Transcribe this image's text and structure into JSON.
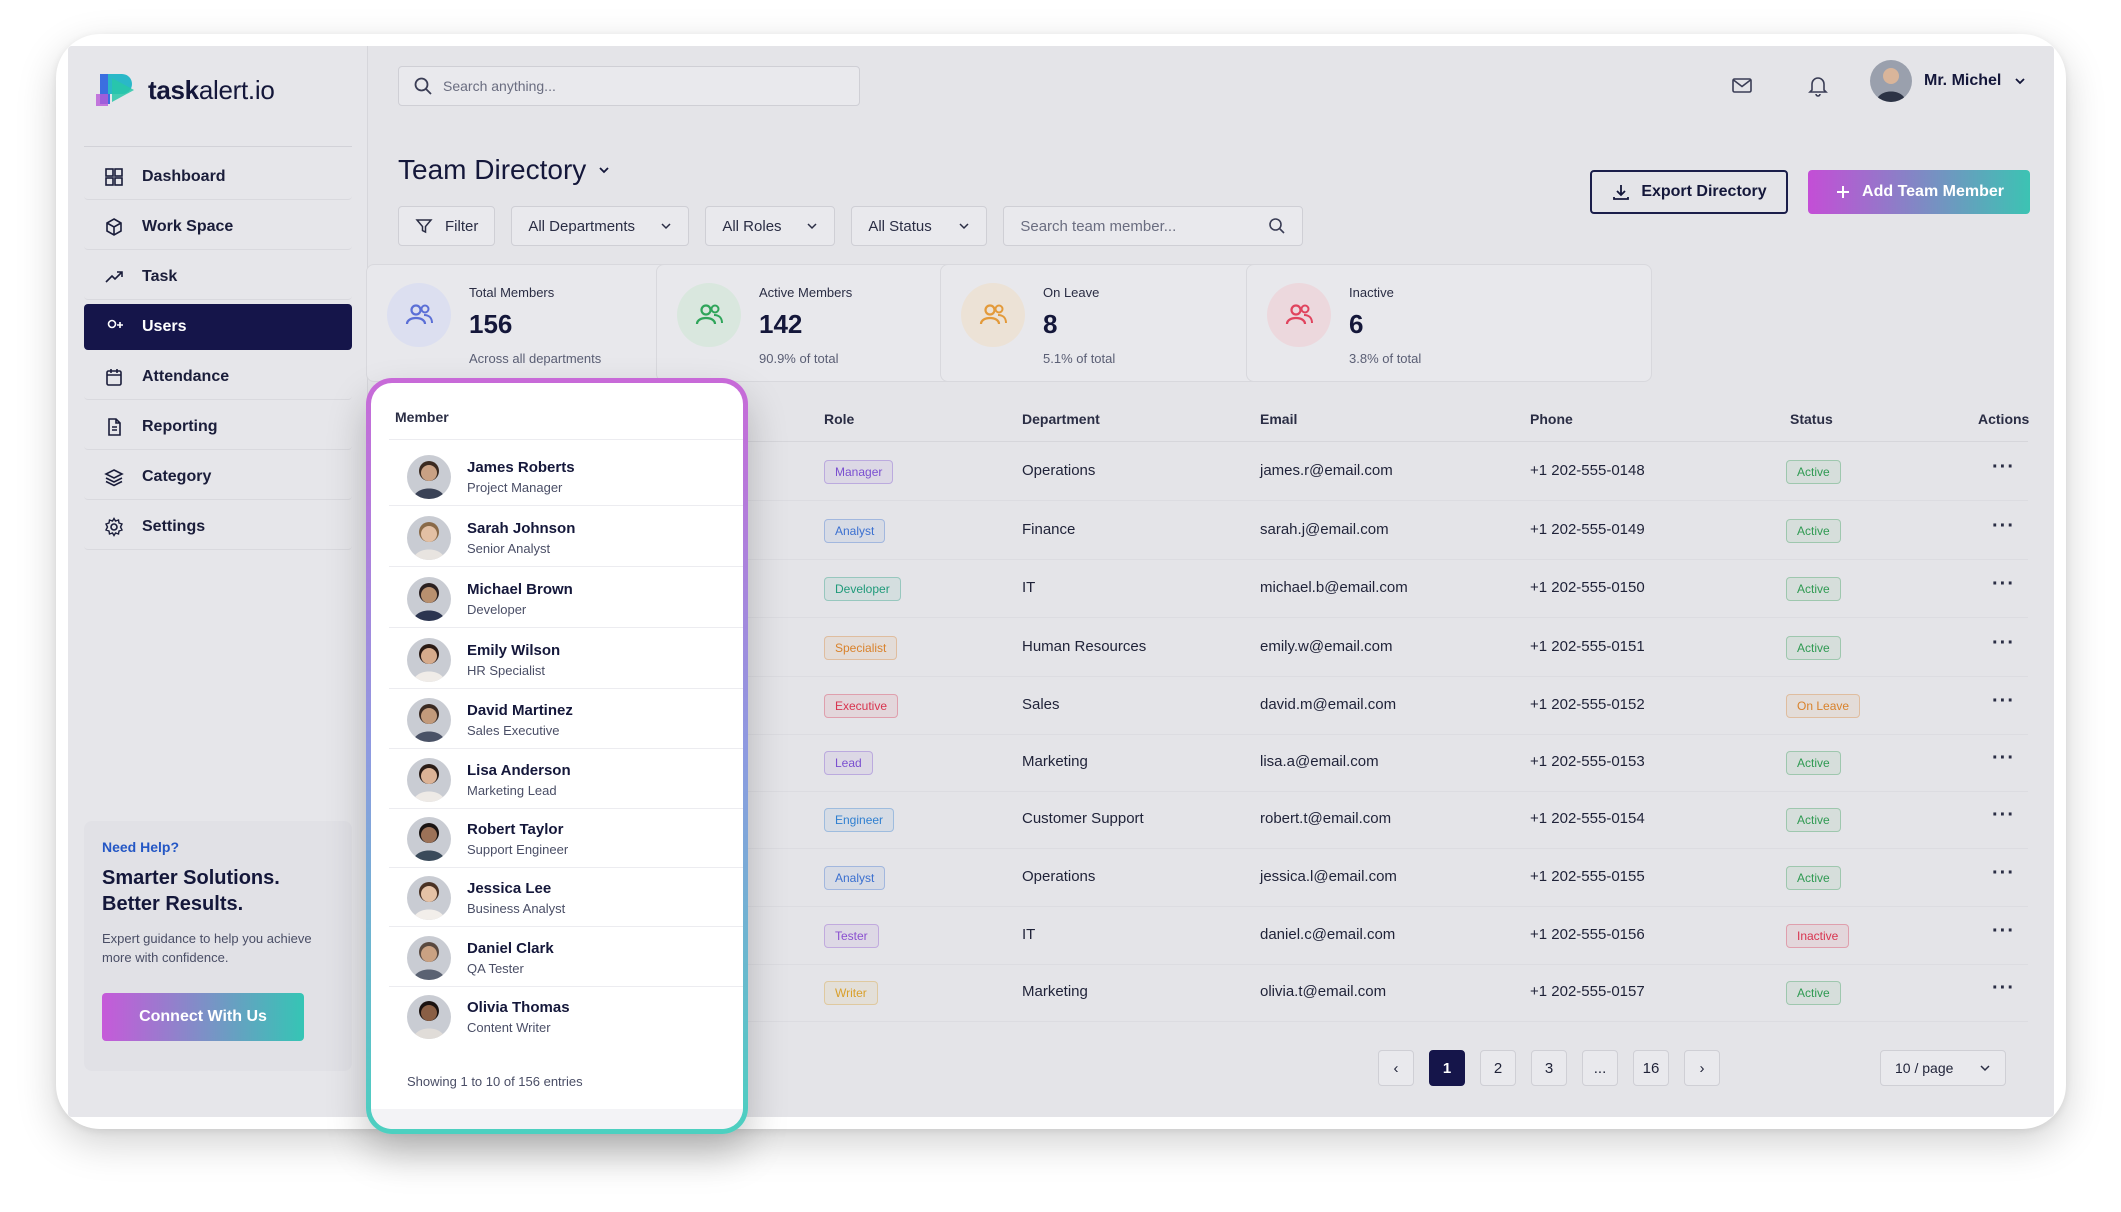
{
  "brand": {
    "name_bold": "task",
    "name_light": "alert.io"
  },
  "nav": [
    {
      "label": "Dashboard",
      "icon": "grid-icon"
    },
    {
      "label": "Work Space",
      "icon": "cube-icon"
    },
    {
      "label": "Task",
      "icon": "trend-icon"
    },
    {
      "label": "Users",
      "icon": "user-add-icon",
      "active": true
    },
    {
      "label": "Attendance",
      "icon": "calendar-icon"
    },
    {
      "label": "Reporting",
      "icon": "document-icon"
    },
    {
      "label": "Category",
      "icon": "layers-icon"
    },
    {
      "label": "Settings",
      "icon": "gear-icon"
    }
  ],
  "help": {
    "kicker": "Need Help?",
    "title_line1": "Smarter Solutions.",
    "title_line2": "Better Results.",
    "desc": "Expert guidance to help you achieve more with confidence.",
    "button": "Connect With Us"
  },
  "topbar": {
    "search_placeholder": "Search anything...",
    "user_name": "Mr. Michel"
  },
  "header": {
    "title": "Team Directory",
    "export_label": "Export Directory",
    "add_label": "Add Team Member"
  },
  "filters": {
    "filter_label": "Filter",
    "departments": "All Departments",
    "roles": "All Roles",
    "status": "All Status",
    "search_placeholder": "Search team member..."
  },
  "stats": [
    {
      "label": "Total Members",
      "value": "156",
      "sub": "Across all departments",
      "color": "#5b6fd6",
      "bg": "#dcdff0"
    },
    {
      "label": "Active Members",
      "value": "142",
      "sub": "90.9% of total",
      "color": "#2fa55a",
      "bg": "#d9e7de"
    },
    {
      "label": "On Leave",
      "value": "8",
      "sub": "5.1% of total",
      "color": "#e39a3a",
      "bg": "#ece2d6"
    },
    {
      "label": "Inactive",
      "value": "6",
      "sub": "3.8% of total",
      "color": "#e0445e",
      "bg": "#ecd8dd"
    }
  ],
  "table": {
    "headers": {
      "member": "Member",
      "role": "Role",
      "department": "Department",
      "email": "Email",
      "phone": "Phone",
      "status": "Status",
      "actions": "Actions"
    },
    "rows": [
      {
        "name": "James Roberts",
        "title": "Project Manager",
        "role": "Manager",
        "dept": "Operations",
        "email": "james.r@email.com",
        "phone": "+1 202-555-0148",
        "status": "Active"
      },
      {
        "name": "Sarah Johnson",
        "title": "Senior Analyst",
        "role": "Analyst",
        "dept": "Finance",
        "email": "sarah.j@email.com",
        "phone": "+1 202-555-0149",
        "status": "Active"
      },
      {
        "name": "Michael Brown",
        "title": "Developer",
        "role": "Developer",
        "dept": "IT",
        "email": "michael.b@email.com",
        "phone": "+1 202-555-0150",
        "status": "Active"
      },
      {
        "name": "Emily Wilson",
        "title": "HR Specialist",
        "role": "Specialist",
        "dept": "Human Resources",
        "email": "emily.w@email.com",
        "phone": "+1 202-555-0151",
        "status": "Active"
      },
      {
        "name": "David Martinez",
        "title": "Sales Executive",
        "role": "Executive",
        "dept": "Sales",
        "email": "david.m@email.com",
        "phone": "+1 202-555-0152",
        "status": "On Leave"
      },
      {
        "name": "Lisa Anderson",
        "title": "Marketing Lead",
        "role": "Lead",
        "dept": "Marketing",
        "email": "lisa.a@email.com",
        "phone": "+1 202-555-0153",
        "status": "Active"
      },
      {
        "name": "Robert Taylor",
        "title": "Support Engineer",
        "role": "Engineer",
        "dept": "Customer Support",
        "email": "robert.t@email.com",
        "phone": "+1 202-555-0154",
        "status": "Active"
      },
      {
        "name": "Jessica Lee",
        "title": "Business Analyst",
        "role": "Analyst",
        "dept": "Operations",
        "email": "jessica.l@email.com",
        "phone": "+1 202-555-0155",
        "status": "Active"
      },
      {
        "name": "Daniel Clark",
        "title": "QA Tester",
        "role": "Tester",
        "dept": "IT",
        "email": "daniel.c@email.com",
        "phone": "+1 202-555-0156",
        "status": "Inactive"
      },
      {
        "name": "Olivia Thomas",
        "title": "Content Writer",
        "role": "Writer",
        "dept": "Marketing",
        "email": "olivia.t@email.com",
        "phone": "+1 202-555-0157",
        "status": "Active"
      }
    ],
    "footer": "Showing 1 to 10 of 156 entries"
  },
  "role_colors": {
    "Manager": "#7a4fd0",
    "Analyst": "#3a6fd0",
    "Developer": "#1f9a7a",
    "Specialist": "#d9822b",
    "Executive": "#d8344f",
    "Lead": "#7a4fd0",
    "Engineer": "#2f7fd0",
    "Tester": "#8a4fd0",
    "Writer": "#d9a02b"
  },
  "status_colors": {
    "Active": "#2f9a52",
    "On Leave": "#d9822b",
    "Inactive": "#d8344f"
  },
  "pagination": {
    "prev": "‹",
    "pages": [
      "1",
      "2",
      "3",
      "...",
      "16"
    ],
    "next": "›",
    "per_page": "10 / page"
  }
}
